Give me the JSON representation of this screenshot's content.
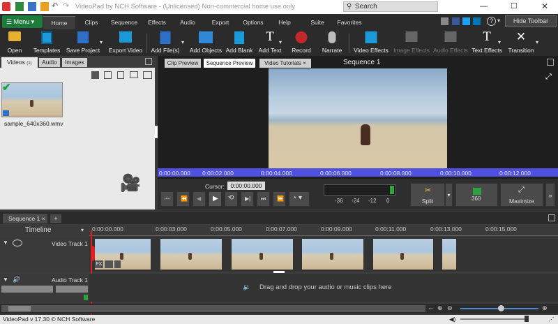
{
  "app": {
    "title": "VideoPad by NCH Software - (Unlicensed) Non-commercial home use only",
    "search_placeholder": "Search",
    "status": "VideoPad v 17.30 © NCH Software"
  },
  "menu": {
    "menu_button": "Menu",
    "tabs": [
      "Home",
      "Clips",
      "Sequence",
      "Effects",
      "Audio",
      "Export",
      "Options",
      "Help",
      "Suite",
      "Favorites"
    ],
    "hide_toolbar": "Hide Toolbar"
  },
  "toolbar": {
    "open": "Open",
    "templates": "Templates",
    "save_project": "Save Project",
    "export_video": "Export Video",
    "add_files": "Add File(s)",
    "add_objects": "Add Objects",
    "add_blank": "Add Blank",
    "add_text": "Add Text",
    "record": "Record",
    "narrate": "Narrate",
    "video_effects": "Video Effects",
    "image_effects": "Image Effects",
    "audio_effects": "Audio Effects",
    "text_effects": "Text Effects",
    "transition": "Transition"
  },
  "bin": {
    "tabs": [
      "Videos",
      "Audio",
      "Images"
    ],
    "videos_count": "(1)",
    "clip_name": "sample_640x360.wmv"
  },
  "preview": {
    "tabs": [
      "Clip Preview",
      "Sequence Preview",
      "Video Tutorials"
    ],
    "sequence_title": "Sequence 1",
    "ruler": [
      "0:00:00.000",
      "0:00:02.000",
      "0:00:04.000",
      "0:00:06.000",
      "0:00:08.000",
      "0:00:10.000",
      "0:00:12.000"
    ],
    "cursor_label": "Cursor:",
    "cursor_value": "0:00:00.000",
    "meter": [
      "-36",
      "-24",
      "-12",
      "0"
    ],
    "split": "Split",
    "vr": "360",
    "maximize": "Maximize"
  },
  "timeline": {
    "sequence_tab": "Sequence 1",
    "timeline_label": "Timeline",
    "ruler": [
      "0:00:00.000",
      "0:00:03.000",
      "0:00:05.000",
      "0:00:07.000",
      "0:00:09.000",
      "0:00:11.000",
      "0:00:13.000",
      "0:00:15.000"
    ],
    "video_track": "Video Track 1",
    "audio_track": "Audio Track 1",
    "drop_hint": "Drag and drop your audio or music clips here",
    "fx": "FX"
  },
  "colors": {
    "accent": "#1e7b3c",
    "highlight": "#5050e0",
    "playhead": "#e02020"
  }
}
